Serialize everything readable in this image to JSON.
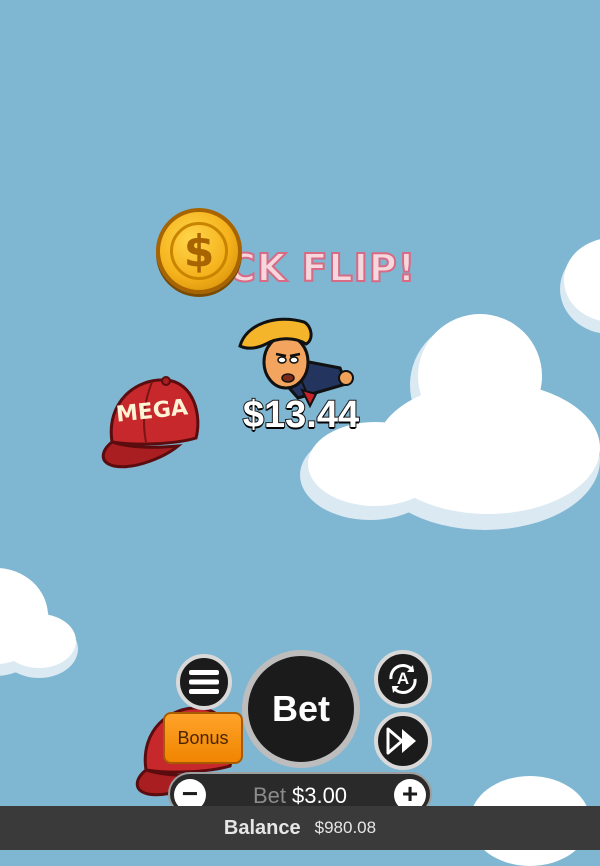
{
  "game": {
    "banner_text": "CK FLIP!",
    "win_amount": "$13.44",
    "cap_text": "MEGA",
    "coin_symbol": "$"
  },
  "controls": {
    "bet_button_label": "Bet",
    "bonus_label": "Bonus",
    "bet_label": "Bet",
    "bet_value": "$3.00",
    "minus_symbol": "−",
    "plus_symbol": "+",
    "auto_symbol": "A"
  },
  "footer": {
    "balance_label": "Balance",
    "balance_value": "$980.08"
  },
  "icons": {
    "menu": "hamburger-menu-icon",
    "auto": "autoplay-icon",
    "fast_forward": "fast-forward-icon",
    "coin": "dollar-coin-icon",
    "cap": "red-cap-icon",
    "character": "flying-character-icon"
  },
  "colors": {
    "sky": "#7fb6d2",
    "bonus": "#f08500",
    "banner_outline": "#d76a84",
    "cap_red": "#c6282b"
  }
}
